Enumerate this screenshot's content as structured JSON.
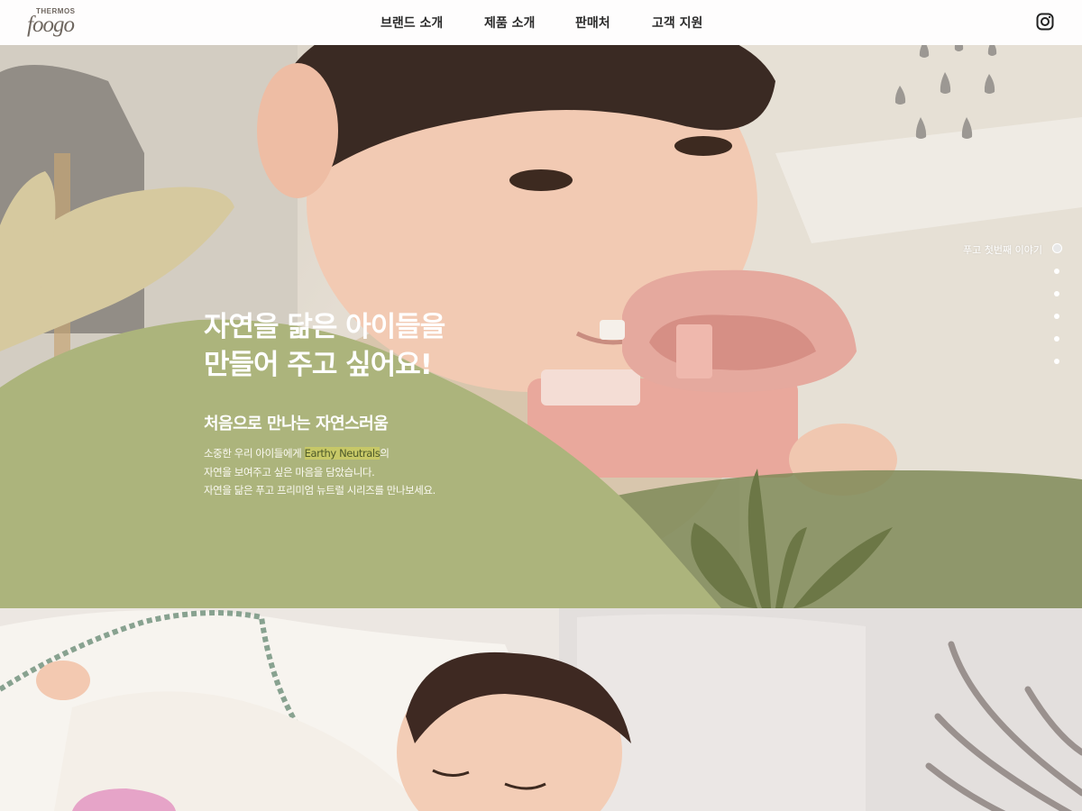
{
  "brand": {
    "logo_top": "THERMOS",
    "logo_main": "foogo"
  },
  "nav": {
    "items": [
      {
        "label": "브랜드 소개"
      },
      {
        "label": "제품 소개"
      },
      {
        "label": "판매처"
      },
      {
        "label": "고객 지원"
      }
    ],
    "social_icon": "instagram-icon"
  },
  "hero": {
    "headline_line1": "자연을 닮은 아이들을",
    "headline_line2": "만들어 주고 싶어요!",
    "subtitle": "처음으로 만나는 자연스러움",
    "body_line1_pre": "소중한 우리 아이들에게 ",
    "body_line1_highlight": "Earthy Neutrals",
    "body_line1_post": "의",
    "body_line2": "자연을 보여주고 싶은 마음을 담았습니다.",
    "body_line3": "자연을 닮은 푸고 프리미엄 뉴트럴 시리즈를 만나보세요."
  },
  "side_nav": {
    "label": "푸고 첫번째 이야기",
    "dots": 6,
    "active_index": 0
  },
  "colors": {
    "olive": "#acb47c",
    "dark_olive": "#6c7746",
    "sand": "#d6c99f",
    "highlight": "#c7c867"
  }
}
